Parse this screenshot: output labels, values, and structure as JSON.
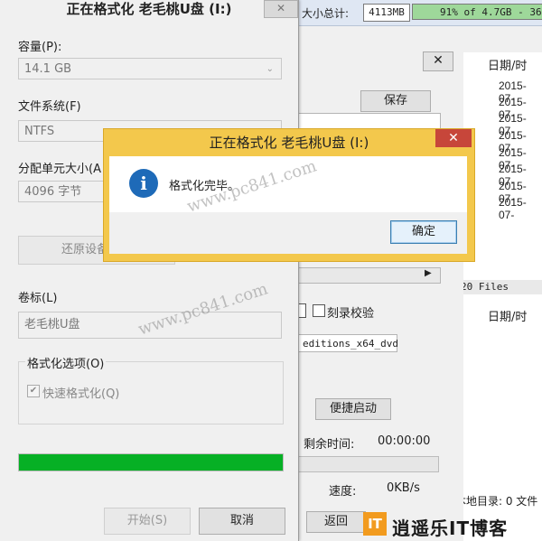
{
  "background_app": {
    "total_label": "大小总计:",
    "total_value": "4113MB",
    "usage_text": "91% of 4.7GB - 36",
    "date_header": "日期/时",
    "dates": [
      "2015-07-",
      "2015-07-",
      "2015-07-",
      "2015-07-",
      "2015-07-",
      "2015-07-",
      "2015-07-",
      "2015-07-"
    ],
    "files_header": "20 Files",
    "date_header_2": "日期/时",
    "local_dir": "本地目录: 0 文件",
    "save_label": "保存",
    "verify_label": "刻录校验",
    "iso_name": "editions_x64_dvd",
    "quick_boot_label": "便捷启动",
    "remain_label": "剩余时间:",
    "remain_value": "00:00:00",
    "speed_label": "速度:",
    "speed_value": "0KB/s",
    "back_label": "返回"
  },
  "format_dialog": {
    "title": "正在格式化 老毛桃U盘 (I:)",
    "capacity_label": "容量(P):",
    "capacity_value": "14.1 GB",
    "filesystem_label": "文件系统(F)",
    "filesystem_value": "NTFS",
    "alloc_label": "分配单元大小(A",
    "alloc_value": "4096 字节",
    "restore_label": "还原设备的默",
    "volume_label": "卷标(L)",
    "volume_value": "老毛桃U盘",
    "options_legend": "格式化选项(O)",
    "quick_format_label": "快速格式化(Q)",
    "progress_fraction": 1.0,
    "start_label": "开始(S)",
    "cancel_label": "取消"
  },
  "message_box": {
    "title": "正在格式化 老毛桃U盘 (I:)",
    "message": "格式化完毕。",
    "ok_label": "确定",
    "icon": "info-icon"
  },
  "watermarks": {
    "site": "www.pc841.com",
    "logo_mark": "IT",
    "logo_text": "逍遥乐IT博客"
  },
  "colors": {
    "progress": "#06b025",
    "message_frame": "#f3c84c",
    "close_red": "#c7463a",
    "info_blue": "#1e6ab8"
  }
}
